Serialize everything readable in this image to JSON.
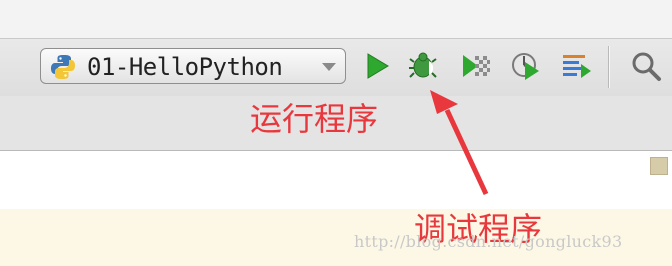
{
  "toolbar": {
    "run_configuration": {
      "name": "01-HelloPython",
      "icon": "python-logo-icon",
      "dropdown_icon": "chevron-down-icon"
    },
    "buttons": [
      {
        "name": "run",
        "icon": "run-triangle-icon",
        "color": "#2fa82f"
      },
      {
        "name": "debug",
        "icon": "bug-icon",
        "color": "#3b9a3b"
      },
      {
        "name": "run-with-coverage",
        "icon": "coverage-icon",
        "color": "#2fa82f"
      },
      {
        "name": "profile",
        "icon": "profile-icon",
        "color": "#2fa82f"
      },
      {
        "name": "run-concurrency",
        "icon": "concurrency-icon",
        "color": "#3a7bd5"
      },
      {
        "name": "search",
        "icon": "search-icon"
      }
    ]
  },
  "annotations": {
    "run_program": "运行程序",
    "debug_program": "调试程序",
    "color": "#e8383d"
  },
  "watermark": "http://blog.csdn.net/gongluck93"
}
